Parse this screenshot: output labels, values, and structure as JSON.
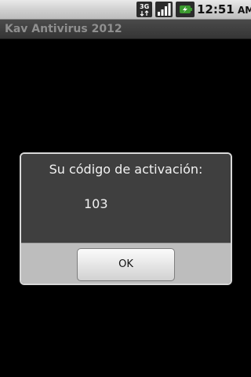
{
  "status_bar": {
    "time": "12:51",
    "time_suffix": "AM",
    "network_type": "3G",
    "icons": [
      "3g-icon",
      "signal-icon",
      "battery-icon"
    ],
    "battery_accent": "#3b9a2f"
  },
  "app": {
    "title": "Kav Antivirus 2012"
  },
  "dialog": {
    "message": "Su código de activación:",
    "code": "103",
    "ok_label": "OK"
  }
}
